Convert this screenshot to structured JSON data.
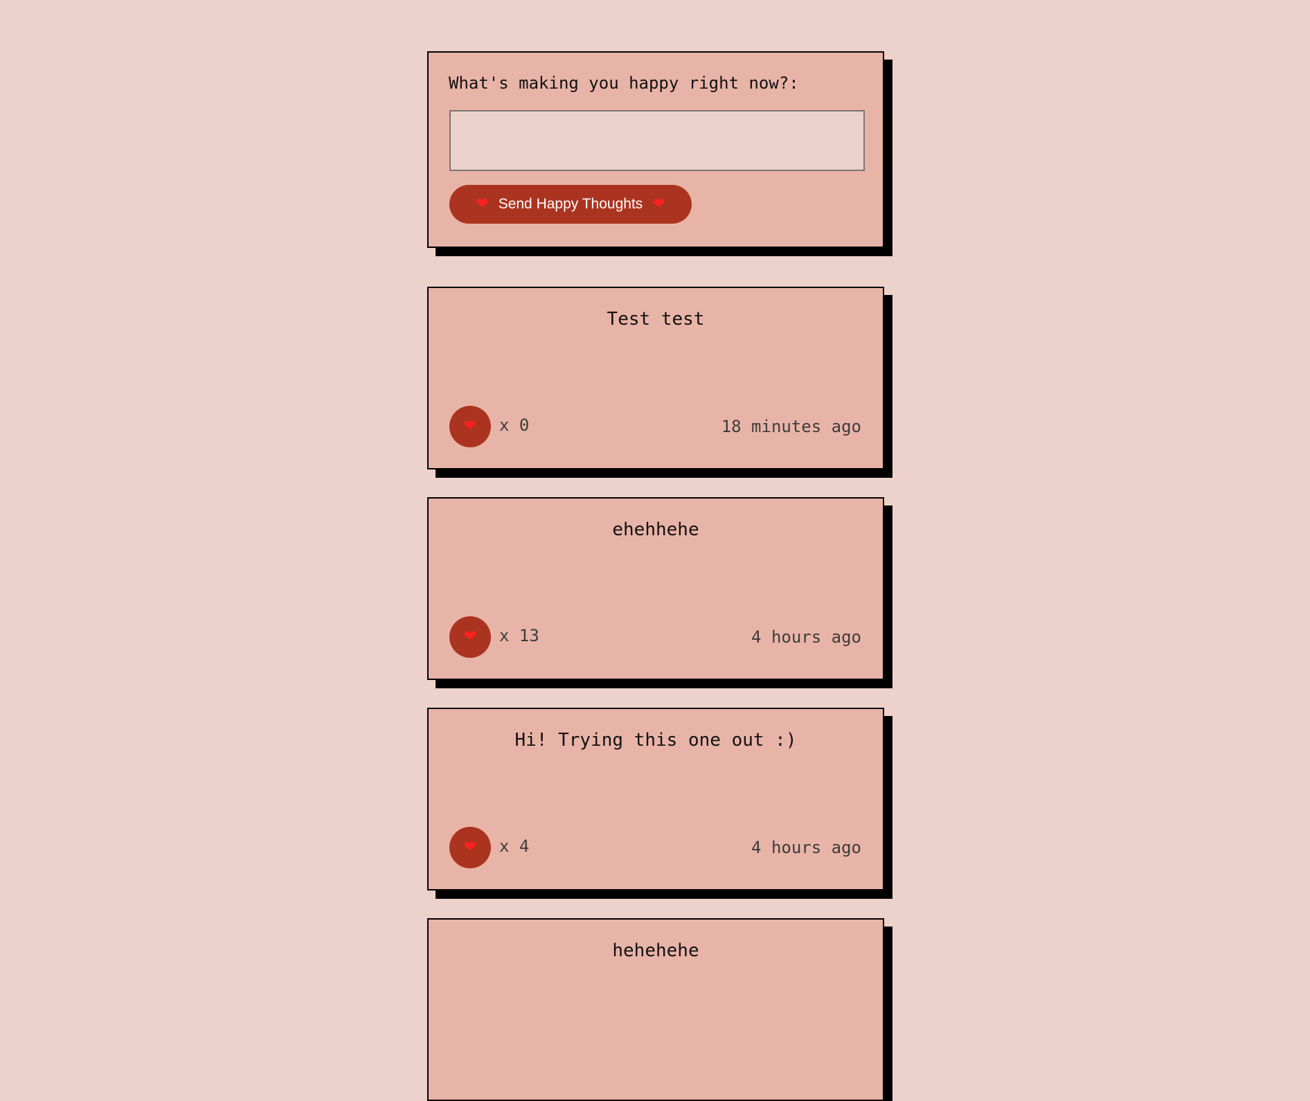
{
  "form": {
    "label": "What's making you happy right now?:",
    "input_value": "",
    "input_placeholder": "",
    "button_label": "Send Happy Thoughts"
  },
  "colors": {
    "background": "#ecd2cb",
    "card": "#e9b4a8",
    "accent": "#ab3420",
    "heart": "#ff1f1f"
  },
  "icons": {
    "heart": "❤"
  },
  "thoughts": [
    {
      "text": "Test test",
      "likes": "x 0",
      "time": "18 minutes ago"
    },
    {
      "text": "ehehhehe",
      "likes": "x 13",
      "time": "4 hours ago"
    },
    {
      "text": "Hi! Trying this one out :)",
      "likes": "x 4",
      "time": "4 hours ago"
    },
    {
      "text": "hehehehe",
      "likes": "",
      "time": ""
    }
  ]
}
